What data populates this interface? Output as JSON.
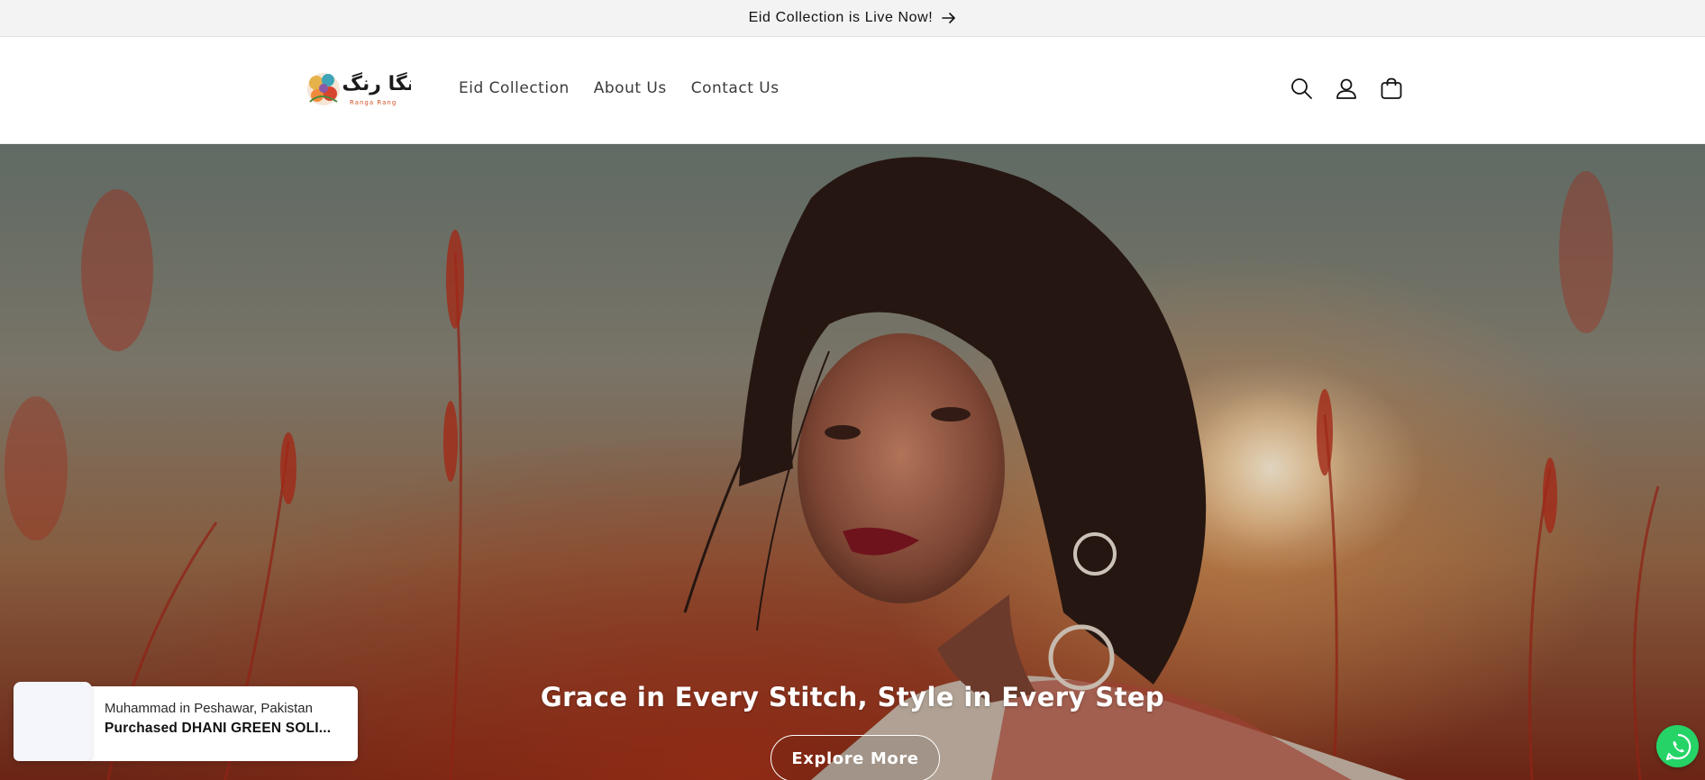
{
  "announcement": {
    "text": "Eid Collection is Live Now!",
    "icon": "arrow-right-icon"
  },
  "header": {
    "logo": {
      "urdu_text": "رنگا رنگ",
      "subtitle": "Ranga Rang"
    },
    "nav": [
      {
        "label": "Eid Collection"
      },
      {
        "label": "About Us"
      },
      {
        "label": "Contact Us"
      }
    ],
    "icons": [
      "search-icon",
      "account-icon",
      "cart-icon"
    ]
  },
  "hero": {
    "heading": "Grace in Every Stitch, Style in Every Step",
    "button_label": "Explore More"
  },
  "purchase_popup": {
    "line1": "Muhammad in Peshawar, Pakistan",
    "line2": "Purchased DHANI GREEN SOLI..."
  },
  "whatsapp": {
    "icon": "whatsapp-icon"
  },
  "colors": {
    "announcement_bg": "#f3f3f3",
    "header_bg": "#ffffff",
    "nav_text": "#3b3b3b",
    "whatsapp_green": "#25d366"
  }
}
